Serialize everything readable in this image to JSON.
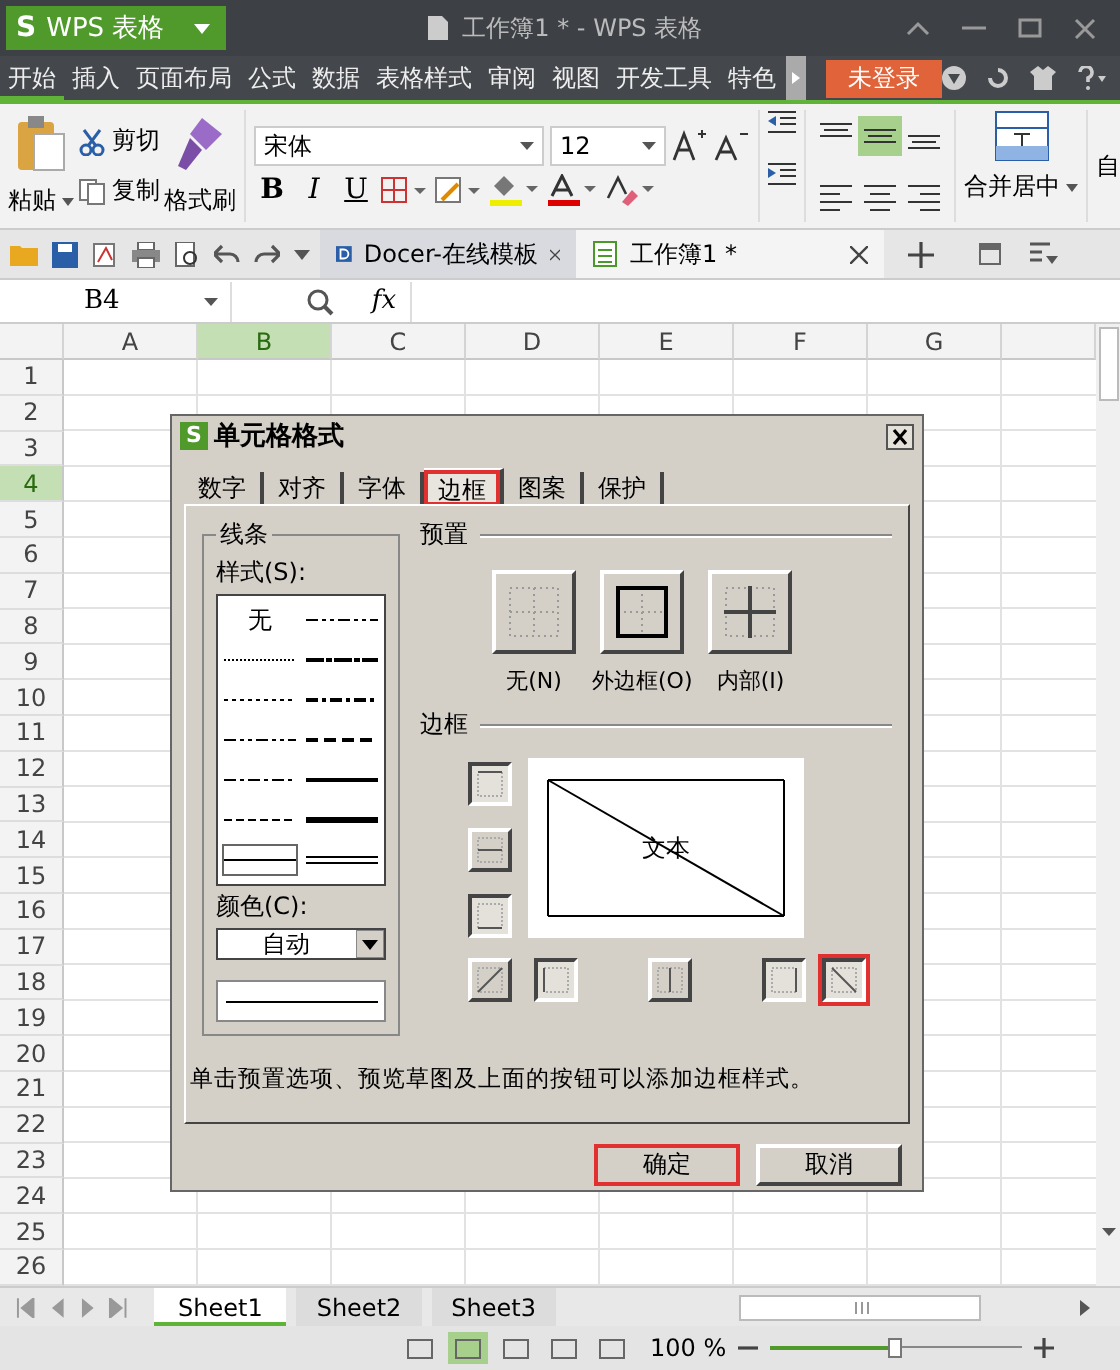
{
  "app_button": {
    "logo": "S",
    "label": "WPS 表格"
  },
  "window": {
    "title": "工作簿1 * - WPS 表格"
  },
  "menu_tabs": [
    {
      "label": "开始",
      "selected": true
    },
    {
      "label": "插入",
      "selected": false
    },
    {
      "label": "页面布局",
      "selected": false
    },
    {
      "label": "公式",
      "selected": false
    },
    {
      "label": "数据",
      "selected": false
    },
    {
      "label": "表格样式",
      "selected": false
    },
    {
      "label": "审阅",
      "selected": false
    },
    {
      "label": "视图",
      "selected": false
    },
    {
      "label": "开发工具",
      "selected": false
    },
    {
      "label": "特色",
      "selected": false
    }
  ],
  "login_button": {
    "label": "未登录"
  },
  "ribbon": {
    "paste": "粘贴",
    "cut": "剪切",
    "copy": "复制",
    "format_painter": "格式刷",
    "font_name": "宋体",
    "font_size": "12",
    "format_buttons": [
      "B",
      "I",
      "U"
    ],
    "merge": "合并居中",
    "next_group": "自"
  },
  "doc_tabs": [
    {
      "label": "Docer-在线模板",
      "selected": false
    },
    {
      "label": "工作簿1 *",
      "selected": true
    }
  ],
  "formula_bar": {
    "name_box": "B4",
    "fx": "fx"
  },
  "columns": [
    {
      "label": "A",
      "selected": false
    },
    {
      "label": "B",
      "selected": true
    },
    {
      "label": "C",
      "selected": false
    },
    {
      "label": "D",
      "selected": false
    },
    {
      "label": "E",
      "selected": false
    },
    {
      "label": "F",
      "selected": false
    },
    {
      "label": "G",
      "selected": false
    }
  ],
  "rows": [
    {
      "label": "1",
      "selected": false
    },
    {
      "label": "2",
      "selected": false
    },
    {
      "label": "3",
      "selected": false
    },
    {
      "label": "4",
      "selected": true
    },
    {
      "label": "5",
      "selected": false
    },
    {
      "label": "6",
      "selected": false
    },
    {
      "label": "7",
      "selected": false
    },
    {
      "label": "8",
      "selected": false
    },
    {
      "label": "9",
      "selected": false
    },
    {
      "label": "10",
      "selected": false
    },
    {
      "label": "11",
      "selected": false
    },
    {
      "label": "12",
      "selected": false
    },
    {
      "label": "13",
      "selected": false
    },
    {
      "label": "14",
      "selected": false
    },
    {
      "label": "15",
      "selected": false
    },
    {
      "label": "16",
      "selected": false
    },
    {
      "label": "17",
      "selected": false
    },
    {
      "label": "18",
      "selected": false
    },
    {
      "label": "19",
      "selected": false
    },
    {
      "label": "20",
      "selected": false
    },
    {
      "label": "21",
      "selected": false
    },
    {
      "label": "22",
      "selected": false
    },
    {
      "label": "23",
      "selected": false
    },
    {
      "label": "24",
      "selected": false
    },
    {
      "label": "25",
      "selected": false
    },
    {
      "label": "26",
      "selected": false
    }
  ],
  "dialog": {
    "logo": "S",
    "title": "单元格格式",
    "tabs": [
      {
        "label": "数字",
        "selected": false,
        "highlighted": false
      },
      {
        "label": "对齐",
        "selected": false,
        "highlighted": false
      },
      {
        "label": "字体",
        "selected": false,
        "highlighted": false
      },
      {
        "label": "边框",
        "selected": true,
        "highlighted": true
      },
      {
        "label": "图案",
        "selected": false,
        "highlighted": false
      },
      {
        "label": "保护",
        "selected": false,
        "highlighted": false
      }
    ],
    "line_group": "线条",
    "style_label": "样式(S):",
    "styles": [
      {
        "kind": "none",
        "label": "无",
        "selected": false
      },
      {
        "kind": "dashdotdot",
        "selected": false
      },
      {
        "kind": "hair",
        "selected": false
      },
      {
        "kind": "slantdashdot",
        "selected": false
      },
      {
        "kind": "dotted",
        "selected": false
      },
      {
        "kind": "mediumdashdot",
        "selected": false
      },
      {
        "kind": "dashdotdot",
        "selected": false
      },
      {
        "kind": "mediumdashed",
        "selected": false
      },
      {
        "kind": "dashdot",
        "selected": false
      },
      {
        "kind": "medium",
        "selected": false
      },
      {
        "kind": "dashed",
        "selected": false
      },
      {
        "kind": "thick",
        "selected": false
      },
      {
        "kind": "thin",
        "selected": true
      },
      {
        "kind": "double",
        "selected": false
      }
    ],
    "color_label": "颜色(C):",
    "color_value": "自动",
    "preset_group": "预置",
    "presets": [
      {
        "kind": "none",
        "label": "无(N)"
      },
      {
        "kind": "outline",
        "label": "外边框(O)"
      },
      {
        "kind": "inside",
        "label": "内部(I)"
      }
    ],
    "border_group": "边框",
    "preview_text": "文本",
    "borders": {
      "top": {
        "on": true,
        "highlighted": false
      },
      "middle": {
        "on": false,
        "highlighted": false
      },
      "bottom": {
        "on": true,
        "highlighted": false
      },
      "diag_up": {
        "on": false,
        "highlighted": false
      },
      "left": {
        "on": true,
        "highlighted": false
      },
      "center": {
        "on": false,
        "highlighted": false
      },
      "right": {
        "on": true,
        "highlighted": false
      },
      "diag_down": {
        "on": true,
        "highlighted": true
      }
    },
    "hint": "单击预置选项、预览草图及上面的按钮可以添加边框样式。",
    "buttons": [
      {
        "label": "确定",
        "highlighted": true
      },
      {
        "label": "取消",
        "highlighted": false
      }
    ]
  },
  "sheet_tabs": [
    {
      "label": "Sheet1",
      "selected": true
    },
    {
      "label": "Sheet2",
      "selected": false
    },
    {
      "label": "Sheet3",
      "selected": false
    }
  ],
  "zoom": {
    "reading": "100 %",
    "level": 0.5
  }
}
